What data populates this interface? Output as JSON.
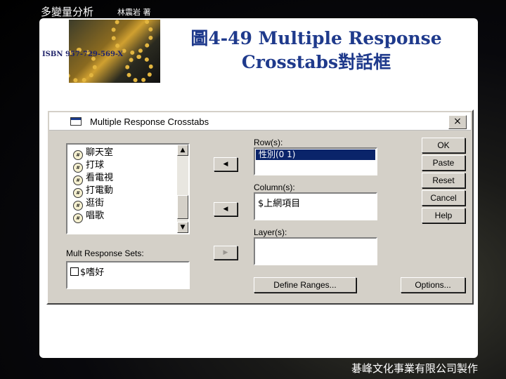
{
  "header": {
    "book_title": "多變量分析",
    "author": "林震岩 著",
    "isbn": "ISBN 957-729-569-X",
    "slide_title_line1": "圖4-49  Multiple Response",
    "slide_title_line2": "Crosstabs對話框"
  },
  "dialog": {
    "title": "Multiple Response Crosstabs",
    "close_label": "×",
    "variables": [
      "聊天室",
      "打球",
      "看電視",
      "打電動",
      "逛街",
      "唱歌"
    ],
    "variable_icon_label": "#",
    "mult_response_label": "Mult Response Sets:",
    "mult_response_items": [
      "$嗜好"
    ],
    "row_label": "Row(s):",
    "row_items": [
      "性別(0 1)"
    ],
    "column_label": "Column(s):",
    "column_items": [
      "$上網項目"
    ],
    "layer_label": "Layer(s):",
    "arrow_row": "◀",
    "arrow_column": "◀",
    "arrow_layer": "▶",
    "scroll_up": "▲",
    "scroll_down": "▼",
    "buttons": {
      "ok": "OK",
      "paste": "Paste",
      "reset": "Reset",
      "cancel": "Cancel",
      "help": "Help",
      "define_ranges": "Define Ranges...",
      "options": "Options..."
    }
  },
  "footer": "碁峰文化事業有限公司製作",
  "colors": {
    "title_blue": "#1f3a8c",
    "selection": "#0a246a",
    "dialog_face": "#d4d0c8"
  }
}
